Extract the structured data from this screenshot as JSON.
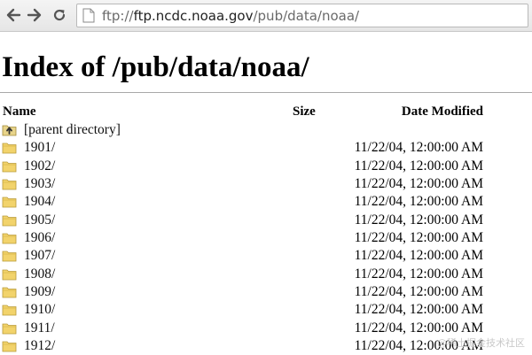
{
  "browser": {
    "url_prefix": "ftp://",
    "url_host": "ftp.ncdc.noaa.gov",
    "url_path": "/pub/data/noaa/"
  },
  "page": {
    "title": "Index of /pub/data/noaa/"
  },
  "table": {
    "columns": {
      "name": "Name",
      "size": "Size",
      "date": "Date Modified"
    },
    "parent": {
      "label": "[parent directory]"
    },
    "rows": [
      {
        "name": "1901/",
        "size": "",
        "date": "11/22/04, 12:00:00 AM"
      },
      {
        "name": "1902/",
        "size": "",
        "date": "11/22/04, 12:00:00 AM"
      },
      {
        "name": "1903/",
        "size": "",
        "date": "11/22/04, 12:00:00 AM"
      },
      {
        "name": "1904/",
        "size": "",
        "date": "11/22/04, 12:00:00 AM"
      },
      {
        "name": "1905/",
        "size": "",
        "date": "11/22/04, 12:00:00 AM"
      },
      {
        "name": "1906/",
        "size": "",
        "date": "11/22/04, 12:00:00 AM"
      },
      {
        "name": "1907/",
        "size": "",
        "date": "11/22/04, 12:00:00 AM"
      },
      {
        "name": "1908/",
        "size": "",
        "date": "11/22/04, 12:00:00 AM"
      },
      {
        "name": "1909/",
        "size": "",
        "date": "11/22/04, 12:00:00 AM"
      },
      {
        "name": "1910/",
        "size": "",
        "date": "11/22/04, 12:00:00 AM"
      },
      {
        "name": "1911/",
        "size": "",
        "date": "11/22/04, 12:00:00 AM"
      },
      {
        "name": "1912/",
        "size": "",
        "date": "11/22/04, 12:00:00 AM"
      }
    ]
  },
  "watermark": "@稀土掘金技术社区",
  "icons": {
    "back": "back-arrow-icon",
    "forward": "forward-arrow-icon",
    "reload": "reload-icon",
    "page": "page-icon",
    "parent": "parent-directory-icon",
    "folder": "folder-icon"
  },
  "colors": {
    "folder": "#f2d36b",
    "toolbar": "#ececec",
    "url_path": "#6a6a6a"
  }
}
